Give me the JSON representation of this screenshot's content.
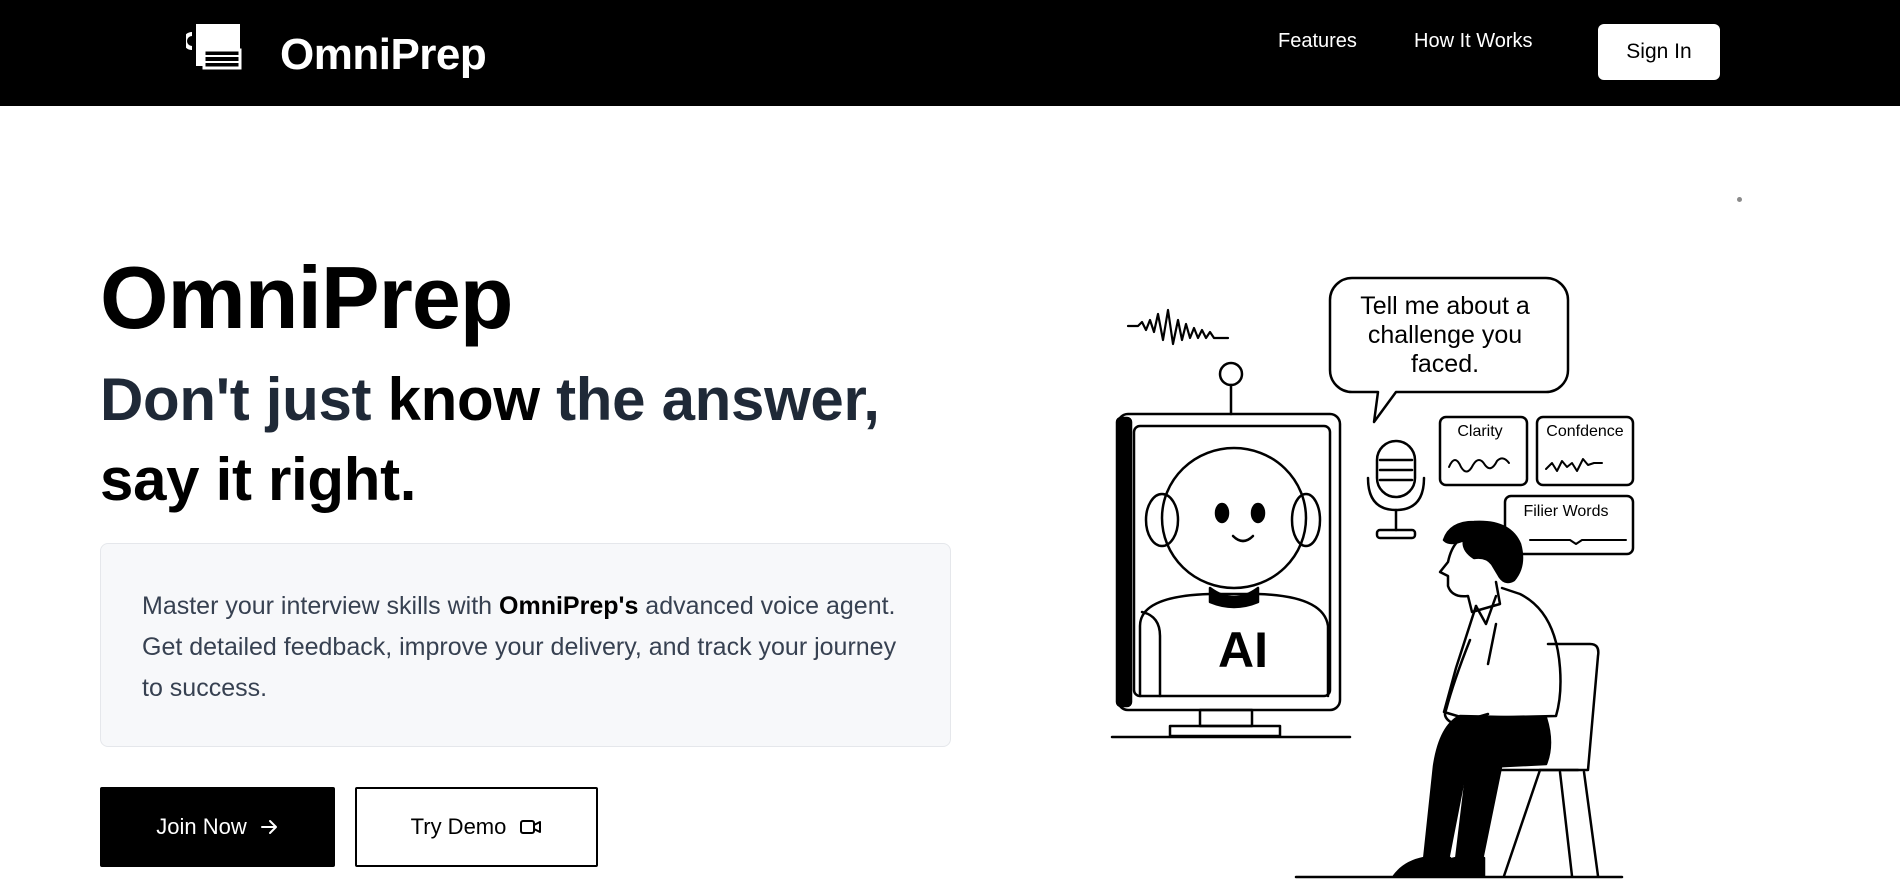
{
  "nav": {
    "brand": "OmniPrep",
    "links": [
      {
        "label": "Features"
      },
      {
        "label": "How It Works"
      }
    ],
    "signin_label": "Sign In"
  },
  "hero": {
    "title": "OmniPrep",
    "tagline_part1": "Don't just ",
    "tagline_em1": "know",
    "tagline_part2": " the answer,",
    "tagline_em2": "say it right.",
    "description_part1": "Master your interview skills with ",
    "description_brand": "OmniPrep's",
    "description_part2": " advanced voice agent. Get detailed feedback, improve your delivery, and track your journey to success.",
    "join_label": "Join Now",
    "demo_label": "Try Demo"
  },
  "illustration": {
    "speech_bubble": "Tell me about a challenge you faced.",
    "metric_clarity": "Clarity",
    "metric_confidence": "Confdence",
    "metric_filler": "Filier Words",
    "screen_label": "AI"
  },
  "icons": {
    "logo": "book-mug-icon",
    "join_arrow": "arrow-right-icon",
    "demo_video": "video-camera-icon"
  }
}
